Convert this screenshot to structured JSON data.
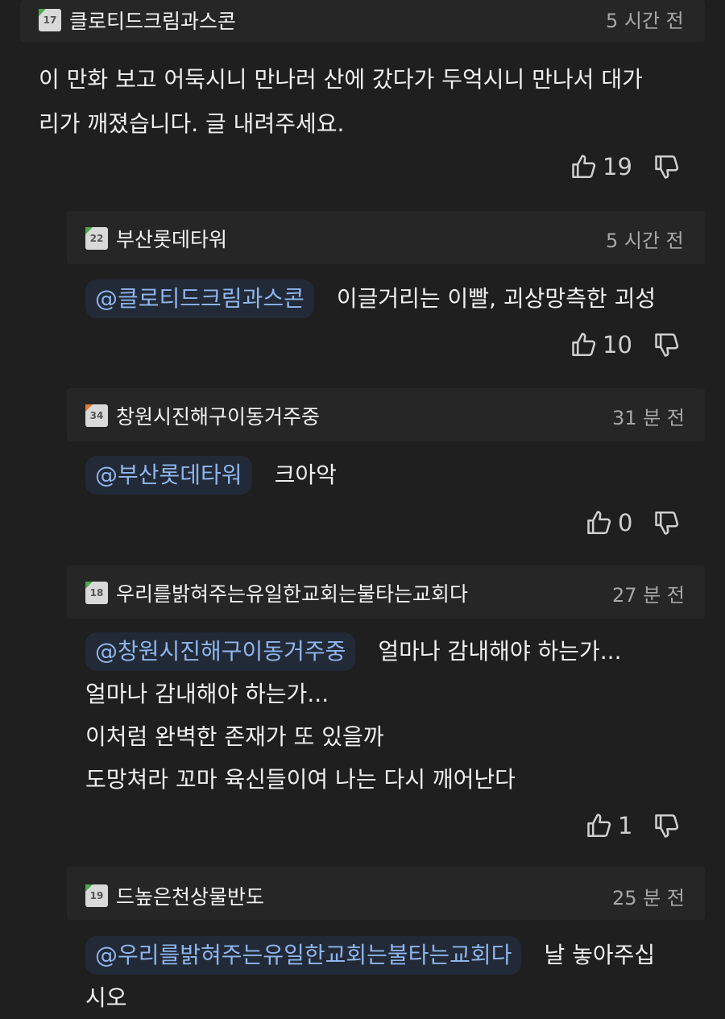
{
  "comments": [
    {
      "level": "17",
      "level_color": "#4aa84a",
      "author": "클로티드크림과스콘",
      "time": "5 시간 전",
      "mention": "",
      "lines": [
        "이 만화 보고 어둑시니 만나러 산에 갔다가 두억시니 만나서 대가",
        "리가 깨졌습니다. 글 내려주세요."
      ],
      "likes": "19"
    },
    {
      "level": "22",
      "level_color": "#4aa84a",
      "author": "부산롯데타워",
      "time": "5 시간 전",
      "mention": "@클로티드크림과스콘",
      "lines": [
        "이글거리는 이빨, 괴상망측한 괴성"
      ],
      "likes": "10"
    },
    {
      "level": "34",
      "level_color": "#e0782e",
      "author": "창원시진해구이동거주중",
      "time": "31 분 전",
      "mention": "@부산롯데타워",
      "lines": [
        "크아악"
      ],
      "likes": "0"
    },
    {
      "level": "18",
      "level_color": "#4aa84a",
      "author": "우리를밝혀주는유일한교회는불타는교회다",
      "time": "27 분 전",
      "mention": "@창원시진해구이동거주중",
      "lines": [
        "얼마나 감내해야 하는가...",
        "얼마나 감내해야 하는가...",
        "이처럼 완벽한 존재가 또 있을까",
        "도망쳐라 꼬마 육신들이여 나는 다시 깨어난다"
      ],
      "likes": "1"
    },
    {
      "level": "19",
      "level_color": "#4aa84a",
      "author": "드높은천상물반도",
      "time": "25 분 전",
      "mention": "@우리를밝혀주는유일한교회는불타는교회다",
      "lines": [
        "날 놓아주십",
        "시오"
      ]
    }
  ],
  "icons": {
    "like": "thumbs-up-icon",
    "dislike": "thumbs-down-icon"
  }
}
